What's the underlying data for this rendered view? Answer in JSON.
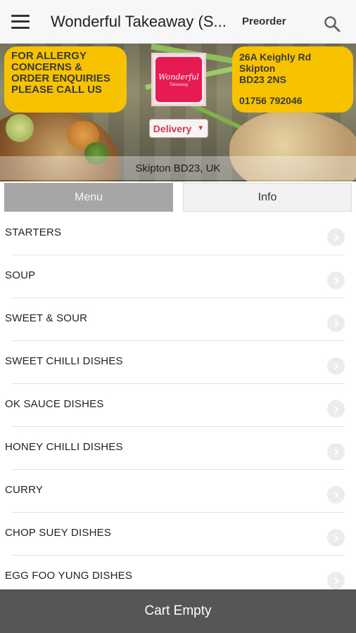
{
  "appbar": {
    "title": "Wonderful Takeaway (S...",
    "preorder_label": "Preorder",
    "menu_icon": "hamburger-menu-icon",
    "search_icon": "search-icon"
  },
  "hero": {
    "allergy_notice": "FOR ALLERGY CONCERNS & ORDER ENQUIRIES PLEASE CALL US",
    "address_line1": "26A Keighly Rd",
    "address_line2": "Skipton",
    "address_line3": "BD23 2NS",
    "phone": "01756 792046",
    "logo_text": "Wonderful",
    "logo_subtext": "Takeaway",
    "order_type": "Delivery",
    "location": "Skipton BD23, UK"
  },
  "tabs": {
    "menu_label": "Menu",
    "info_label": "Info",
    "active": "Menu"
  },
  "categories": [
    "STARTERS",
    "SOUP",
    "SWEET & SOUR",
    "SWEET CHILLI DISHES",
    "OK SAUCE DISHES",
    "HONEY CHILLI DISHES",
    "CURRY",
    "CHOP SUEY DISHES",
    "EGG FOO YUNG DISHES"
  ],
  "cart": {
    "label": "Cart Empty"
  },
  "colors": {
    "accent_yellow": "#f7c300",
    "logo_red": "#e61b52",
    "delivery_red": "#d23a4a",
    "tab_active": "#a6a6a6",
    "cart_bar": "#565656"
  }
}
